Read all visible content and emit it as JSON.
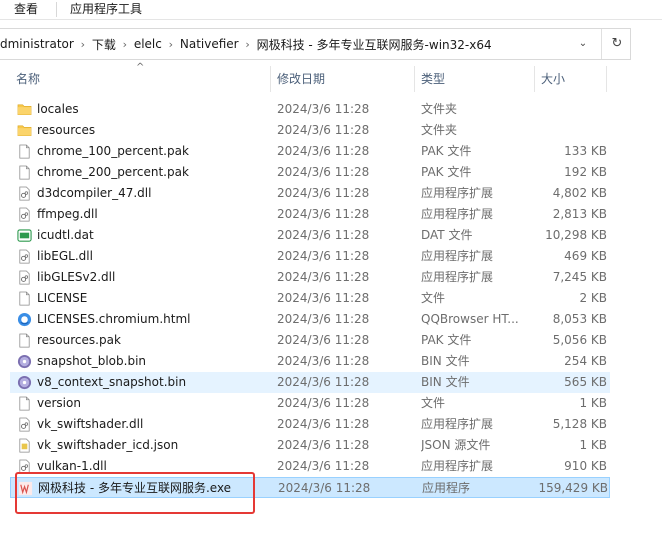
{
  "ribbon": {
    "tab_view": "查看",
    "tab_app_tools": "应用程序工具"
  },
  "address": {
    "crumbs": [
      "dministrator",
      "下载",
      "elelc",
      "Nativefier",
      "网极科技 - 多年专业互联网服务-win32-x64"
    ],
    "separator": "›",
    "dropdown_glyph": "⌄",
    "refresh_glyph": "↻"
  },
  "columns": {
    "name": "名称",
    "date": "修改日期",
    "type": "类型",
    "size": "大小"
  },
  "sort_glyph": "^",
  "files": [
    {
      "name": "locales",
      "date": "2024/3/6 11:28",
      "type": "文件夹",
      "size": "",
      "icon": "folder-icon"
    },
    {
      "name": "resources",
      "date": "2024/3/6 11:28",
      "type": "文件夹",
      "size": "",
      "icon": "folder-icon"
    },
    {
      "name": "chrome_100_percent.pak",
      "date": "2024/3/6 11:28",
      "type": "PAK 文件",
      "size": "133 KB",
      "icon": "file-icon"
    },
    {
      "name": "chrome_200_percent.pak",
      "date": "2024/3/6 11:28",
      "type": "PAK 文件",
      "size": "192 KB",
      "icon": "file-icon"
    },
    {
      "name": "d3dcompiler_47.dll",
      "date": "2024/3/6 11:28",
      "type": "应用程序扩展",
      "size": "4,802 KB",
      "icon": "dll-icon"
    },
    {
      "name": "ffmpeg.dll",
      "date": "2024/3/6 11:28",
      "type": "应用程序扩展",
      "size": "2,813 KB",
      "icon": "dll-icon"
    },
    {
      "name": "icudtl.dat",
      "date": "2024/3/6 11:28",
      "type": "DAT 文件",
      "size": "10,298 KB",
      "icon": "dat-icon"
    },
    {
      "name": "libEGL.dll",
      "date": "2024/3/6 11:28",
      "type": "应用程序扩展",
      "size": "469 KB",
      "icon": "dll-icon"
    },
    {
      "name": "libGLESv2.dll",
      "date": "2024/3/6 11:28",
      "type": "应用程序扩展",
      "size": "7,245 KB",
      "icon": "dll-icon"
    },
    {
      "name": "LICENSE",
      "date": "2024/3/6 11:28",
      "type": "文件",
      "size": "2 KB",
      "icon": "file-icon"
    },
    {
      "name": "LICENSES.chromium.html",
      "date": "2024/3/6 11:28",
      "type": "QQBrowser HT...",
      "size": "8,053 KB",
      "icon": "browser-icon"
    },
    {
      "name": "resources.pak",
      "date": "2024/3/6 11:28",
      "type": "PAK 文件",
      "size": "5,056 KB",
      "icon": "file-icon"
    },
    {
      "name": "snapshot_blob.bin",
      "date": "2024/3/6 11:28",
      "type": "BIN 文件",
      "size": "254 KB",
      "icon": "disc-icon"
    },
    {
      "name": "v8_context_snapshot.bin",
      "date": "2024/3/6 11:28",
      "type": "BIN 文件",
      "size": "565 KB",
      "icon": "disc-icon"
    },
    {
      "name": "version",
      "date": "2024/3/6 11:28",
      "type": "文件",
      "size": "1 KB",
      "icon": "file-icon"
    },
    {
      "name": "vk_swiftshader.dll",
      "date": "2024/3/6 11:28",
      "type": "应用程序扩展",
      "size": "5,128 KB",
      "icon": "dll-icon"
    },
    {
      "name": "vk_swiftshader_icd.json",
      "date": "2024/3/6 11:28",
      "type": "JSON 源文件",
      "size": "1 KB",
      "icon": "json-icon"
    },
    {
      "name": "vulkan-1.dll",
      "date": "2024/3/6 11:28",
      "type": "应用程序扩展",
      "size": "910 KB",
      "icon": "dll-icon"
    },
    {
      "name": "网极科技 - 多年专业互联网服务.exe",
      "date": "2024/3/6 11:28",
      "type": "应用程序",
      "size": "159,429 KB",
      "icon": "app-icon"
    }
  ],
  "hover_index": 13,
  "selected_index": 18,
  "colors": {
    "hover": "#e5f3ff",
    "selected": "#cce8ff",
    "highlight": "#e53935",
    "folder": "#f8c84a"
  }
}
